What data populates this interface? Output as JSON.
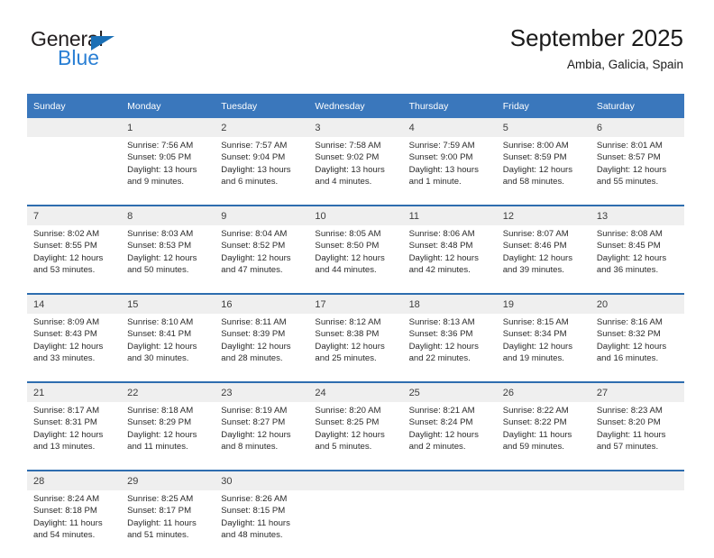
{
  "brand": {
    "name_top": "General",
    "name_bottom": "Blue",
    "triangle_color": "#1a6fb5",
    "blue_text_color": "#2a7fd4"
  },
  "header": {
    "title": "September 2025",
    "subtitle": "Ambia, Galicia, Spain",
    "header_bg": "#3a77bc",
    "row_band_bg": "#efefef",
    "separator_color": "#2e6daf"
  },
  "weekday_headers": [
    "Sunday",
    "Monday",
    "Tuesday",
    "Wednesday",
    "Thursday",
    "Friday",
    "Saturday"
  ],
  "weeks": [
    {
      "days": [
        {
          "num": "",
          "sunrise": "",
          "sunset": "",
          "daylight_a": "",
          "daylight_b": ""
        },
        {
          "num": "1",
          "sunrise": "Sunrise: 7:56 AM",
          "sunset": "Sunset: 9:05 PM",
          "daylight_a": "Daylight: 13 hours",
          "daylight_b": "and 9 minutes."
        },
        {
          "num": "2",
          "sunrise": "Sunrise: 7:57 AM",
          "sunset": "Sunset: 9:04 PM",
          "daylight_a": "Daylight: 13 hours",
          "daylight_b": "and 6 minutes."
        },
        {
          "num": "3",
          "sunrise": "Sunrise: 7:58 AM",
          "sunset": "Sunset: 9:02 PM",
          "daylight_a": "Daylight: 13 hours",
          "daylight_b": "and 4 minutes."
        },
        {
          "num": "4",
          "sunrise": "Sunrise: 7:59 AM",
          "sunset": "Sunset: 9:00 PM",
          "daylight_a": "Daylight: 13 hours",
          "daylight_b": "and 1 minute."
        },
        {
          "num": "5",
          "sunrise": "Sunrise: 8:00 AM",
          "sunset": "Sunset: 8:59 PM",
          "daylight_a": "Daylight: 12 hours",
          "daylight_b": "and 58 minutes."
        },
        {
          "num": "6",
          "sunrise": "Sunrise: 8:01 AM",
          "sunset": "Sunset: 8:57 PM",
          "daylight_a": "Daylight: 12 hours",
          "daylight_b": "and 55 minutes."
        }
      ]
    },
    {
      "days": [
        {
          "num": "7",
          "sunrise": "Sunrise: 8:02 AM",
          "sunset": "Sunset: 8:55 PM",
          "daylight_a": "Daylight: 12 hours",
          "daylight_b": "and 53 minutes."
        },
        {
          "num": "8",
          "sunrise": "Sunrise: 8:03 AM",
          "sunset": "Sunset: 8:53 PM",
          "daylight_a": "Daylight: 12 hours",
          "daylight_b": "and 50 minutes."
        },
        {
          "num": "9",
          "sunrise": "Sunrise: 8:04 AM",
          "sunset": "Sunset: 8:52 PM",
          "daylight_a": "Daylight: 12 hours",
          "daylight_b": "and 47 minutes."
        },
        {
          "num": "10",
          "sunrise": "Sunrise: 8:05 AM",
          "sunset": "Sunset: 8:50 PM",
          "daylight_a": "Daylight: 12 hours",
          "daylight_b": "and 44 minutes."
        },
        {
          "num": "11",
          "sunrise": "Sunrise: 8:06 AM",
          "sunset": "Sunset: 8:48 PM",
          "daylight_a": "Daylight: 12 hours",
          "daylight_b": "and 42 minutes."
        },
        {
          "num": "12",
          "sunrise": "Sunrise: 8:07 AM",
          "sunset": "Sunset: 8:46 PM",
          "daylight_a": "Daylight: 12 hours",
          "daylight_b": "and 39 minutes."
        },
        {
          "num": "13",
          "sunrise": "Sunrise: 8:08 AM",
          "sunset": "Sunset: 8:45 PM",
          "daylight_a": "Daylight: 12 hours",
          "daylight_b": "and 36 minutes."
        }
      ]
    },
    {
      "days": [
        {
          "num": "14",
          "sunrise": "Sunrise: 8:09 AM",
          "sunset": "Sunset: 8:43 PM",
          "daylight_a": "Daylight: 12 hours",
          "daylight_b": "and 33 minutes."
        },
        {
          "num": "15",
          "sunrise": "Sunrise: 8:10 AM",
          "sunset": "Sunset: 8:41 PM",
          "daylight_a": "Daylight: 12 hours",
          "daylight_b": "and 30 minutes."
        },
        {
          "num": "16",
          "sunrise": "Sunrise: 8:11 AM",
          "sunset": "Sunset: 8:39 PM",
          "daylight_a": "Daylight: 12 hours",
          "daylight_b": "and 28 minutes."
        },
        {
          "num": "17",
          "sunrise": "Sunrise: 8:12 AM",
          "sunset": "Sunset: 8:38 PM",
          "daylight_a": "Daylight: 12 hours",
          "daylight_b": "and 25 minutes."
        },
        {
          "num": "18",
          "sunrise": "Sunrise: 8:13 AM",
          "sunset": "Sunset: 8:36 PM",
          "daylight_a": "Daylight: 12 hours",
          "daylight_b": "and 22 minutes."
        },
        {
          "num": "19",
          "sunrise": "Sunrise: 8:15 AM",
          "sunset": "Sunset: 8:34 PM",
          "daylight_a": "Daylight: 12 hours",
          "daylight_b": "and 19 minutes."
        },
        {
          "num": "20",
          "sunrise": "Sunrise: 8:16 AM",
          "sunset": "Sunset: 8:32 PM",
          "daylight_a": "Daylight: 12 hours",
          "daylight_b": "and 16 minutes."
        }
      ]
    },
    {
      "days": [
        {
          "num": "21",
          "sunrise": "Sunrise: 8:17 AM",
          "sunset": "Sunset: 8:31 PM",
          "daylight_a": "Daylight: 12 hours",
          "daylight_b": "and 13 minutes."
        },
        {
          "num": "22",
          "sunrise": "Sunrise: 8:18 AM",
          "sunset": "Sunset: 8:29 PM",
          "daylight_a": "Daylight: 12 hours",
          "daylight_b": "and 11 minutes."
        },
        {
          "num": "23",
          "sunrise": "Sunrise: 8:19 AM",
          "sunset": "Sunset: 8:27 PM",
          "daylight_a": "Daylight: 12 hours",
          "daylight_b": "and 8 minutes."
        },
        {
          "num": "24",
          "sunrise": "Sunrise: 8:20 AM",
          "sunset": "Sunset: 8:25 PM",
          "daylight_a": "Daylight: 12 hours",
          "daylight_b": "and 5 minutes."
        },
        {
          "num": "25",
          "sunrise": "Sunrise: 8:21 AM",
          "sunset": "Sunset: 8:24 PM",
          "daylight_a": "Daylight: 12 hours",
          "daylight_b": "and 2 minutes."
        },
        {
          "num": "26",
          "sunrise": "Sunrise: 8:22 AM",
          "sunset": "Sunset: 8:22 PM",
          "daylight_a": "Daylight: 11 hours",
          "daylight_b": "and 59 minutes."
        },
        {
          "num": "27",
          "sunrise": "Sunrise: 8:23 AM",
          "sunset": "Sunset: 8:20 PM",
          "daylight_a": "Daylight: 11 hours",
          "daylight_b": "and 57 minutes."
        }
      ]
    },
    {
      "days": [
        {
          "num": "28",
          "sunrise": "Sunrise: 8:24 AM",
          "sunset": "Sunset: 8:18 PM",
          "daylight_a": "Daylight: 11 hours",
          "daylight_b": "and 54 minutes."
        },
        {
          "num": "29",
          "sunrise": "Sunrise: 8:25 AM",
          "sunset": "Sunset: 8:17 PM",
          "daylight_a": "Daylight: 11 hours",
          "daylight_b": "and 51 minutes."
        },
        {
          "num": "30",
          "sunrise": "Sunrise: 8:26 AM",
          "sunset": "Sunset: 8:15 PM",
          "daylight_a": "Daylight: 11 hours",
          "daylight_b": "and 48 minutes."
        },
        {
          "num": "",
          "sunrise": "",
          "sunset": "",
          "daylight_a": "",
          "daylight_b": ""
        },
        {
          "num": "",
          "sunrise": "",
          "sunset": "",
          "daylight_a": "",
          "daylight_b": ""
        },
        {
          "num": "",
          "sunrise": "",
          "sunset": "",
          "daylight_a": "",
          "daylight_b": ""
        },
        {
          "num": "",
          "sunrise": "",
          "sunset": "",
          "daylight_a": "",
          "daylight_b": ""
        }
      ]
    }
  ]
}
